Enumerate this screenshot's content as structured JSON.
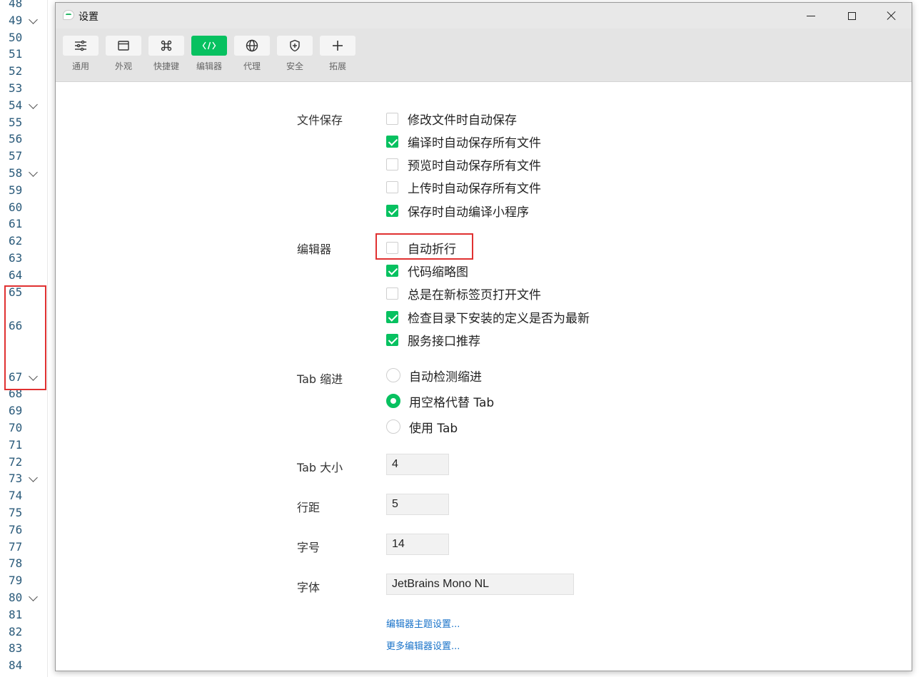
{
  "gutter": {
    "lines": [
      "48",
      "49",
      "50",
      "51",
      "52",
      "53",
      "54",
      "55",
      "56",
      "57",
      "58",
      "59",
      "60",
      "61",
      "62",
      "63",
      "64",
      "65",
      "66",
      "67",
      "68",
      "69",
      "70",
      "71",
      "72",
      "73",
      "74",
      "75",
      "76",
      "77",
      "78",
      "79",
      "80",
      "81",
      "82",
      "83",
      "84"
    ],
    "fold_lines": [
      "49",
      "54",
      "58",
      "67",
      "73",
      "80"
    ]
  },
  "window": {
    "title": "设置",
    "controls": [
      "minimize",
      "maximize",
      "close"
    ]
  },
  "toolbar": {
    "active": "编辑器",
    "tabs": [
      {
        "label": "通用",
        "icon": "sliders-icon"
      },
      {
        "label": "外观",
        "icon": "window-icon"
      },
      {
        "label": "快捷键",
        "icon": "command-key-icon"
      },
      {
        "label": "编辑器",
        "icon": "code-brackets-icon"
      },
      {
        "label": "代理",
        "icon": "globe-icon"
      },
      {
        "label": "安全",
        "icon": "shield-icon"
      },
      {
        "label": "拓展",
        "icon": "plus-icon"
      }
    ]
  },
  "sections": {
    "file_save": {
      "label": "文件保存",
      "options": [
        {
          "label": "修改文件时自动保存",
          "checked": false
        },
        {
          "label": "编译时自动保存所有文件",
          "checked": true
        },
        {
          "label": "预览时自动保存所有文件",
          "checked": false
        },
        {
          "label": "上传时自动保存所有文件",
          "checked": false
        },
        {
          "label": "保存时自动编译小程序",
          "checked": true
        }
      ]
    },
    "editor": {
      "label": "编辑器",
      "options": [
        {
          "label": "自动折行",
          "checked": false
        },
        {
          "label": "代码缩略图",
          "checked": true
        },
        {
          "label": "总是在新标签页打开文件",
          "checked": false
        },
        {
          "label": "检查目录下安装的定义是否为最新",
          "checked": true
        },
        {
          "label": "服务接口推荐",
          "checked": true
        }
      ]
    },
    "tab_indent": {
      "label": "Tab 缩进",
      "options": [
        {
          "label": "自动检测缩进",
          "selected": false
        },
        {
          "label": "用空格代替 Tab",
          "selected": true
        },
        {
          "label": "使用 Tab",
          "selected": false
        }
      ]
    },
    "tab_size": {
      "label": "Tab 大小",
      "value": "4"
    },
    "line_spacing": {
      "label": "行距",
      "value": "5"
    },
    "font_size": {
      "label": "字号",
      "value": "14"
    },
    "font_family": {
      "label": "字体",
      "value": "JetBrains Mono NL"
    }
  },
  "links": {
    "theme_settings": "编辑器主题设置...",
    "more_settings": "更多编辑器设置..."
  },
  "colors": {
    "accent": "#07c160",
    "highlight": "#e03131",
    "link": "#1a73c9"
  }
}
